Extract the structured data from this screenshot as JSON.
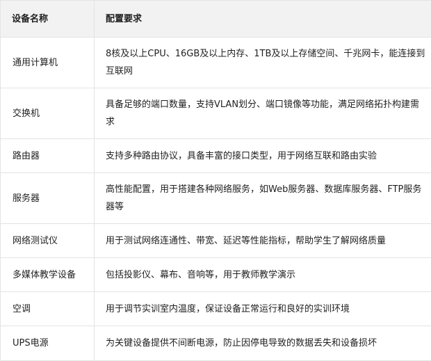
{
  "table": {
    "headers": [
      "设备名称",
      "配置要求"
    ],
    "rows": [
      {
        "name": "通用计算机",
        "requirement": "8核及以上CPU、16GB及以上内存、1TB及以上存储空间、千兆网卡，能连接到互联网"
      },
      {
        "name": "交换机",
        "requirement": "具备足够的端口数量，支持VLAN划分、端口镜像等功能，满足网络拓扑构建需求"
      },
      {
        "name": "路由器",
        "requirement": "支持多种路由协议，具备丰富的接口类型，用于网络互联和路由实验"
      },
      {
        "name": "服务器",
        "requirement": "高性能配置，用于搭建各种网络服务，如Web服务器、数据库服务器、FTP服务器等"
      },
      {
        "name": "网络测试仪",
        "requirement": "用于测试网络连通性、带宽、延迟等性能指标，帮助学生了解网络质量"
      },
      {
        "name": "多媒体教学设备",
        "requirement": "包括投影仪、幕布、音响等，用于教师教学演示"
      },
      {
        "name": "空调",
        "requirement": "用于调节实训室内温度，保证设备正常运行和良好的实训环境"
      },
      {
        "name": "UPS电源",
        "requirement": "为关键设备提供不间断电源，防止因停电导致的数据丢失和设备损坏"
      }
    ]
  }
}
